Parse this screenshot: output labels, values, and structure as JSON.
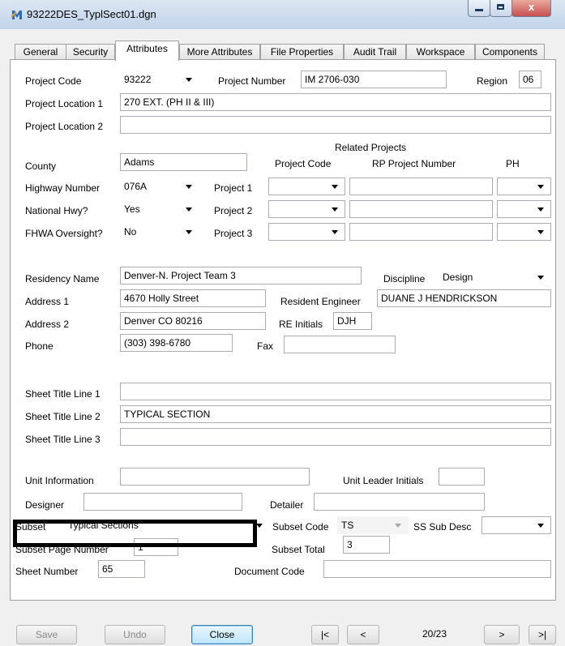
{
  "window": {
    "title": "93222DES_TyplSect01.dgn",
    "close_glyph": "x",
    "icon": "microstation-icon"
  },
  "tabs": [
    {
      "label": "General"
    },
    {
      "label": "Security"
    },
    {
      "label": "Attributes",
      "active": true
    },
    {
      "label": "More Attributes"
    },
    {
      "label": "File Properties"
    },
    {
      "label": "Audit Trail"
    },
    {
      "label": "Workspace"
    },
    {
      "label": "Components"
    }
  ],
  "fields": {
    "project_code": {
      "label": "Project Code",
      "value": "93222"
    },
    "project_number": {
      "label": "Project Number",
      "value": "IM 2706-030"
    },
    "region": {
      "label": "Region",
      "value": "06"
    },
    "project_location_1": {
      "label": "Project Location 1",
      "value": "270 EXT. (PH II & III)"
    },
    "project_location_2": {
      "label": "Project Location 2",
      "value": ""
    },
    "county": {
      "label": "County",
      "value": "Adams"
    },
    "highway_number": {
      "label": "Highway Number",
      "value": "076A"
    },
    "national_hwy": {
      "label": "National Hwy?",
      "value": "Yes"
    },
    "fhwa_oversight": {
      "label": "FHWA Oversight?",
      "value": "No"
    },
    "residency_name": {
      "label": "Residency Name",
      "value": "Denver-N. Project Team 3"
    },
    "discipline": {
      "label": "Discipline",
      "value": "Design"
    },
    "address_1": {
      "label": "Address 1",
      "value": "4670 Holly Street"
    },
    "resident_engineer": {
      "label": "Resident Engineer",
      "value": "DUANE J HENDRICKSON"
    },
    "address_2": {
      "label": "Address 2",
      "value": "Denver CO 80216"
    },
    "re_initials": {
      "label": "RE Initials",
      "value": "DJH"
    },
    "phone": {
      "label": "Phone",
      "value": "(303) 398-6780"
    },
    "fax": {
      "label": "Fax",
      "value": ""
    },
    "sheet_title_1": {
      "label": "Sheet Title Line 1",
      "value": ""
    },
    "sheet_title_2": {
      "label": "Sheet Title Line 2",
      "value": "TYPICAL SECTION"
    },
    "sheet_title_3": {
      "label": "Sheet Title Line 3",
      "value": ""
    },
    "unit_information": {
      "label": "Unit Information",
      "value": ""
    },
    "unit_leader_initials": {
      "label": "Unit Leader Initials",
      "value": ""
    },
    "designer": {
      "label": "Designer",
      "value": ""
    },
    "detailer": {
      "label": "Detailer",
      "value": ""
    },
    "subset": {
      "label": "Subset",
      "value": "Typical Sections"
    },
    "subset_code": {
      "label": "Subset Code",
      "value": "TS"
    },
    "ss_sub_desc": {
      "label": "SS Sub Desc",
      "value": ""
    },
    "subset_page_number": {
      "label": "Subset Page Number",
      "value": "1"
    },
    "subset_total": {
      "label": "Subset Total",
      "value": "3"
    },
    "sheet_number": {
      "label": "Sheet Number",
      "value": "65"
    },
    "document_code": {
      "label": "Document Code",
      "value": ""
    }
  },
  "related_projects": {
    "heading": "Related Projects",
    "col_project_code": "Project Code",
    "col_rp_number": "RP Project Number",
    "col_ph": "PH",
    "rows": [
      {
        "label": "Project 1"
      },
      {
        "label": "Project 2"
      },
      {
        "label": "Project 3"
      }
    ]
  },
  "buttons": {
    "save": "Save",
    "undo": "Undo",
    "close": "Close",
    "first": "|<",
    "prev": "<",
    "next": ">",
    "last": ">|"
  },
  "pager": {
    "indicator": "20/23"
  }
}
